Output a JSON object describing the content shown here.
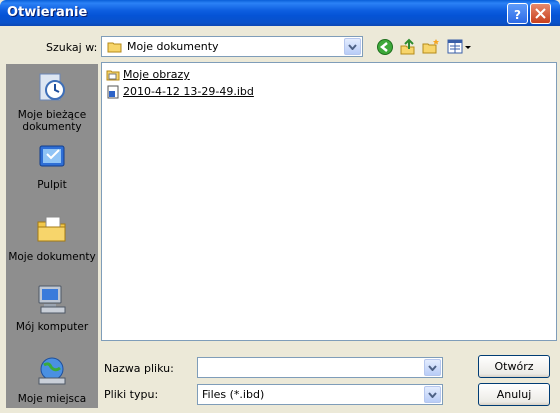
{
  "window": {
    "title": "Otwieranie"
  },
  "lookin": {
    "label": "Szukaj w:",
    "value": "Moje dokumenty"
  },
  "toolbar": {
    "back_icon": "back-arrow-icon",
    "up_icon": "up-folder-icon",
    "new_folder_icon": "new-folder-icon",
    "view_icon": "view-menu-icon"
  },
  "places": [
    {
      "label": "Moje bieżące dokumenty",
      "icon": "recent-documents-icon"
    },
    {
      "label": "Pulpit",
      "icon": "desktop-icon"
    },
    {
      "label": "Moje dokumenty",
      "icon": "my-documents-icon"
    },
    {
      "label": "Mój komputer",
      "icon": "my-computer-icon"
    },
    {
      "label": "Moje miejsca",
      "icon": "network-places-icon"
    }
  ],
  "files": [
    {
      "name": "Moje obrazy",
      "icon": "folder-icon"
    },
    {
      "name": "2010-4-12 13-29-49.ibd",
      "icon": "document-icon"
    }
  ],
  "filename": {
    "label": "Nazwa pliku:",
    "value": ""
  },
  "filetype": {
    "label": "Pliki typu:",
    "value": "Files (*.ibd)"
  },
  "buttons": {
    "open": "Otwórz",
    "cancel": "Anuluj"
  },
  "colors": {
    "titlebar": "#0A52C9",
    "places_bg": "#8E8E8E",
    "window_bg": "#ECE9D8"
  }
}
